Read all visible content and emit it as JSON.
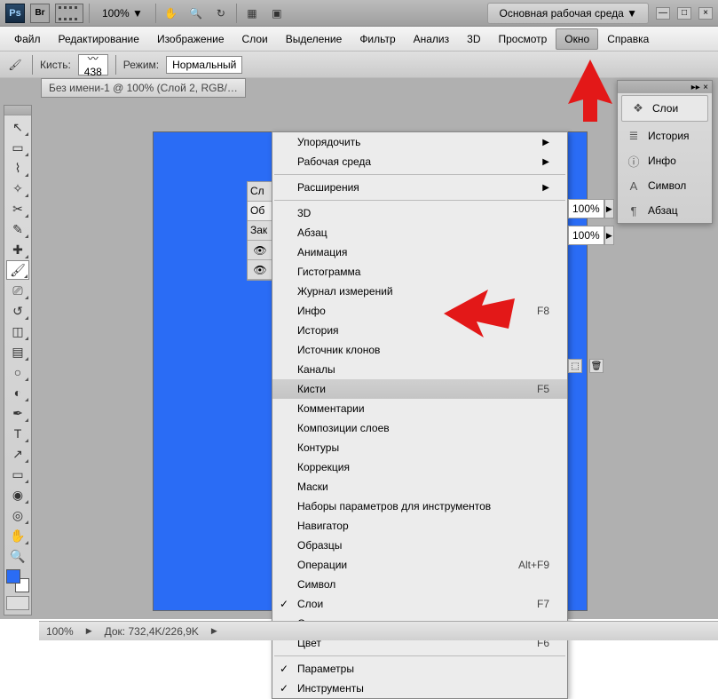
{
  "top": {
    "ps": "Ps",
    "br": "Br",
    "zoom": "100% ▼",
    "workspace": "Основная рабочая среда ▼"
  },
  "menu": {
    "items": [
      "Файл",
      "Редактирование",
      "Изображение",
      "Слои",
      "Выделение",
      "Фильтр",
      "Анализ",
      "3D",
      "Просмотр",
      "Окно",
      "Справка"
    ],
    "active_index": 9
  },
  "options": {
    "brush_label": "Кисть:",
    "brush_size": "438",
    "mode_label": "Режим:",
    "mode_value": "Нормальный"
  },
  "doc_tab": "Без имени-1 @ 100% (Слой 2, RGB/…",
  "dropdown": [
    {
      "label": "Упорядочить",
      "arrow": true
    },
    {
      "label": "Рабочая среда",
      "arrow": true
    },
    {
      "sep": true
    },
    {
      "label": "Расширения",
      "arrow": true
    },
    {
      "sep": true
    },
    {
      "label": "3D"
    },
    {
      "label": "Абзац"
    },
    {
      "label": "Анимация"
    },
    {
      "label": "Гистограмма"
    },
    {
      "label": "Журнал измерений"
    },
    {
      "label": "Инфо",
      "shortcut": "F8"
    },
    {
      "label": "История"
    },
    {
      "label": "Источник клонов"
    },
    {
      "label": "Каналы"
    },
    {
      "label": "Кисти",
      "shortcut": "F5",
      "hl": true
    },
    {
      "label": "Комментарии"
    },
    {
      "label": "Композиции слоев"
    },
    {
      "label": "Контуры"
    },
    {
      "label": "Коррекция"
    },
    {
      "label": "Маски"
    },
    {
      "label": "Наборы параметров для инструментов"
    },
    {
      "label": "Навигатор"
    },
    {
      "label": "Образцы"
    },
    {
      "label": "Операции",
      "shortcut": "Alt+F9"
    },
    {
      "label": "Символ"
    },
    {
      "label": "Слои",
      "shortcut": "F7",
      "check": true
    },
    {
      "label": "Стили"
    },
    {
      "label": "Цвет",
      "shortcut": "F6"
    },
    {
      "sep": true
    },
    {
      "label": "Параметры",
      "check": true
    },
    {
      "label": "Инструменты",
      "check": true
    }
  ],
  "rpanel": {
    "items": [
      {
        "icon": "❖",
        "label": "Слои",
        "active": true
      },
      {
        "icon": "≣",
        "label": "История"
      },
      {
        "icon": "ⓘ",
        "label": "Инфо"
      },
      {
        "icon": "A",
        "label": "Символ"
      },
      {
        "icon": "¶",
        "label": "Абзац"
      }
    ]
  },
  "opacity": "100%",
  "fill": "100%",
  "status": {
    "zoom": "100%",
    "doc": "Док: 732,4K/226,9K"
  },
  "layer_frag": {
    "tab1": "Сл",
    "tab2": "Об",
    "tab3": "Зак"
  }
}
